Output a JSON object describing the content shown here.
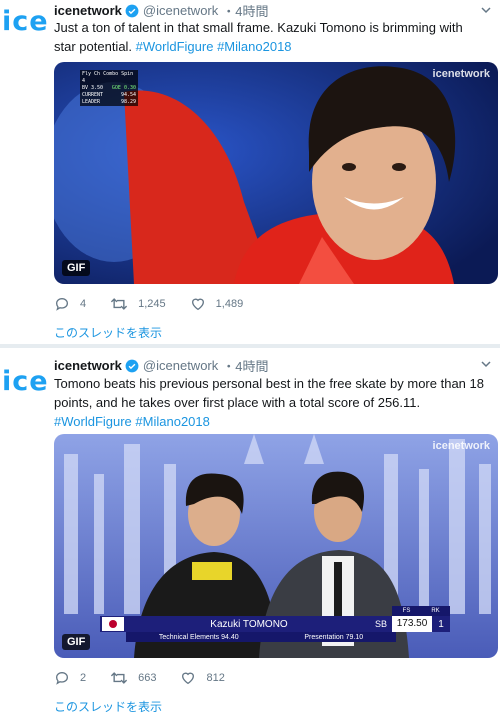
{
  "tweets": [
    {
      "avatar_text": "ice",
      "name": "icenetwork",
      "handle": "@icenetwork",
      "time": "・4時間",
      "text_plain": "Just a ton of talent in that small frame. Kazuki Tomono is brimming with star potential. ",
      "hashtags": [
        "#WorldFigure",
        "#Milano2018"
      ],
      "media": {
        "badge": "GIF",
        "watermark": "icenetwork",
        "scoreboard": {
          "title": "Fly Ch Combo Spin 4",
          "rows": [
            {
              "label": "BV 3.50",
              "value": "GOE 0.30"
            },
            {
              "label": "CURRENT",
              "value": "94.54"
            },
            {
              "label": "LEADER",
              "value": "98.29"
            }
          ]
        }
      },
      "actions": {
        "replies": "4",
        "retweets": "1,245",
        "likes": "1,489"
      },
      "thread_link": "このスレッドを表示"
    },
    {
      "avatar_text": "ice",
      "name": "icenetwork",
      "handle": "@icenetwork",
      "time": "・4時間",
      "text_plain": "Tomono beats his previous personal best in the free skate by more than 18 points, and he takes over first place with a total score of 256.11. ",
      "hashtags": [
        "#WorldFigure",
        "#Milano2018"
      ],
      "media": {
        "badge": "GIF",
        "watermark": "icenetwork",
        "lower_third": {
          "name": "Kazuki TOMONO",
          "segment": "SB",
          "score_header": "FS SCORE",
          "rank_header": "RK",
          "score": "173.50",
          "rank": "1",
          "technical": "Technical Elements 94.40",
          "presentation": "Presentation 79.10"
        }
      },
      "actions": {
        "replies": "2",
        "retweets": "663",
        "likes": "812"
      },
      "thread_link": "このスレッドを表示"
    }
  ],
  "colors": {
    "brand": "#1da1f2",
    "link": "#1b95e0",
    "muted": "#657786"
  },
  "icons": [
    "reply-icon",
    "retweet-icon",
    "like-icon",
    "verified-icon",
    "caret-down-icon"
  ]
}
